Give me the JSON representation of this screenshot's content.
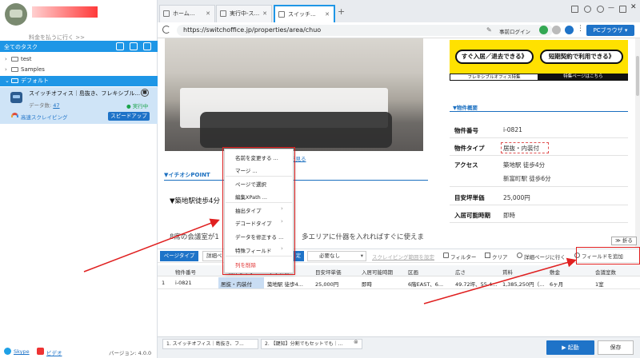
{
  "left_panel": {
    "upgrade_text": "料金を払うに行く >>",
    "toolbar_title": "全てのタスク",
    "tree": [
      {
        "label": "test"
      },
      {
        "label": "Samples"
      },
      {
        "label": "デフォルト"
      }
    ],
    "task": {
      "title": "スイッチオフィス｜島抜き、フレキシブル...",
      "data_label": "データ数:",
      "data_count": "47",
      "status": "● 実行中",
      "speed_label": "高速スクレイピング",
      "speedup_button": "スピードアップ"
    },
    "footer": {
      "skype": "Skype",
      "video": "ビデオ",
      "version": "バージョン: 4.0.0"
    }
  },
  "browser": {
    "tabs": [
      {
        "label": "ホーム..."
      },
      {
        "label": "実行中-ス..."
      },
      {
        "label": "スイッチ..."
      }
    ],
    "url": "https://switchoffice.jp/properties/area/chuo",
    "login_label": "事前ログイン",
    "pc_browser_label": "PCブラウザ ▾"
  },
  "web": {
    "photo_caption": "写真を見る",
    "ichioshi_heading": "▼イチオシPOINT",
    "station_text": "▼築地駅徒歩4分",
    "desc_text": "8席の会議室が1",
    "desc_text_tail": "多エリアに什器を入れればすぐに使えま",
    "banner_left": "すぐ入居／退去できる》",
    "banner_right": "短期契約で利用できる》",
    "banner_foot_left": "フレキシブルオフィス特集",
    "banner_foot_right": "特集ページはこちら",
    "overview_heading": "▼物件概要",
    "overview": [
      {
        "label": "物件番号",
        "value": "i-0821"
      },
      {
        "label": "物件タイプ",
        "value": "居抜・内装付"
      },
      {
        "label": "アクセス",
        "value": "築地駅 徒歩4分"
      },
      {
        "label": "",
        "value": "新富町駅 徒歩6分"
      },
      {
        "label": "目安坪単価",
        "value": "25,000円"
      },
      {
        "label": "入居可能時期",
        "value": "即時"
      }
    ],
    "collapse_label": "≫ 折る"
  },
  "context_menu": [
    "名前を変更する ...",
    "マージ ...",
    "ページで選択",
    "編集XPath ...",
    "抽出タイプ",
    "デコードタイプ",
    "データを修正する ...",
    "特殊フィールド",
    "列を削除"
  ],
  "panel": {
    "page_type_button": "ページタイプ",
    "detail_button": "詳細ペ",
    "set_button": "定",
    "scroll_select": "必要なし",
    "scroll_range_link": "スクレイピング範囲を設定",
    "filter_label": "フィルター",
    "clear_label": "クリア",
    "detail_page_label": "詳細ページに行く",
    "add_field_label": "フィールドを追加",
    "columns": [
      "物件番号",
      "物件タイプ",
      "アクセス",
      "目安坪単価",
      "入居可能時期",
      "区画",
      "広さ",
      "賃料",
      "敷金",
      "会議室数"
    ],
    "rows": [
      {
        "index": "1",
        "cells": [
          "i-0821",
          "居抜・内装付",
          "築地駅 徒歩4...",
          "25,000円",
          "即時",
          "6階EAST、6...",
          "49.72坪、55.4...",
          "1,385,250円（...",
          "6ヶ月",
          "1室"
        ]
      }
    ],
    "bottom_tabs": [
      "1. スイッチオフィス｜島抜き、フ...",
      "2. 【鍵知】分割でもセットでも｜..."
    ],
    "start_button": "▶ 起動",
    "save_button": "保存"
  },
  "colors": {
    "accent": "#1e73c8",
    "highlight": "#1e96e6",
    "callout": "#e02020"
  }
}
